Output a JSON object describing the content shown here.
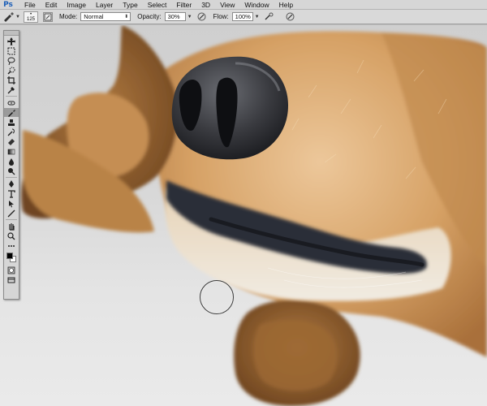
{
  "app": {
    "logo": "Ps"
  },
  "menu": [
    "File",
    "Edit",
    "Image",
    "Layer",
    "Type",
    "Select",
    "Filter",
    "3D",
    "View",
    "Window",
    "Help"
  ],
  "options_bar": {
    "brush_size": "125",
    "mode_label": "Mode:",
    "mode_value": "Normal",
    "opacity_label": "Opacity:",
    "opacity_value": "30%",
    "flow_label": "Flow:",
    "flow_value": "100%"
  },
  "tools_panel": {
    "tools": [
      "move-icon",
      "marquee-icon",
      "lasso-icon",
      "quick-select-icon",
      "crop-icon",
      "eyedropper-icon",
      "healing-brush-icon",
      "brush-icon",
      "clone-stamp-icon",
      "history-brush-icon",
      "eraser-icon",
      "gradient-icon",
      "blur-icon",
      "dodge-icon",
      "pen-icon",
      "type-icon",
      "path-select-icon",
      "shape-icon",
      "hand-icon",
      "zoom-icon",
      "extra-icon"
    ],
    "active_tool": "brush-icon",
    "foreground_color": "#000000",
    "background_color": "#ffffff"
  },
  "colors": {
    "fur_light": "#d8a86a",
    "fur_dark": "#8a5a2c",
    "nose": "#3a3b40",
    "lip": "#2b2f38",
    "accent_blue": "#1c5fb8"
  }
}
